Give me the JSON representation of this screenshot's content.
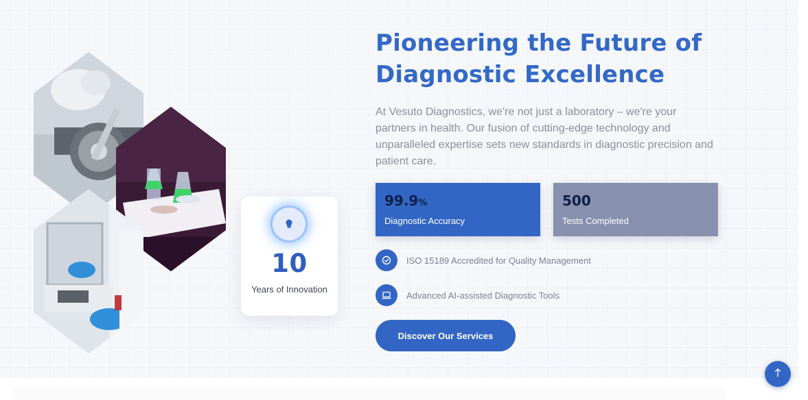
{
  "hero": {
    "headline_line1": "Pioneering the Future of",
    "headline_line2": "Diagnostic Excellence",
    "intro": "At Vesuto Diagnostics, we're not just a laboratory – we're your partners in health. Our fusion of cutting-edge technology and unparalleled expertise sets new standards in diagnostic precision and patient care."
  },
  "years_card": {
    "icon": "award-icon",
    "value": "10",
    "label": "Years of Innovation"
  },
  "stats": [
    {
      "value": "99.9",
      "unit": "%",
      "label": "Diagnostic Accuracy",
      "color": "#3366c4"
    },
    {
      "value": "500",
      "unit": "",
      "label": "Tests Completed",
      "color": "#8790ad"
    }
  ],
  "features": [
    {
      "icon": "check-circle-icon",
      "text": "ISO 15189 Accredited for Quality Management"
    },
    {
      "icon": "laptop-icon",
      "text": "Advanced AI-assisted Diagnostic Tools"
    }
  ],
  "cta": {
    "label": "Discover Our Services"
  },
  "scroll_top": {
    "icon": "arrow-up-icon"
  },
  "colors": {
    "accent": "#3366c4",
    "heading": "#3369c7",
    "muted_stat": "#8790ad"
  }
}
